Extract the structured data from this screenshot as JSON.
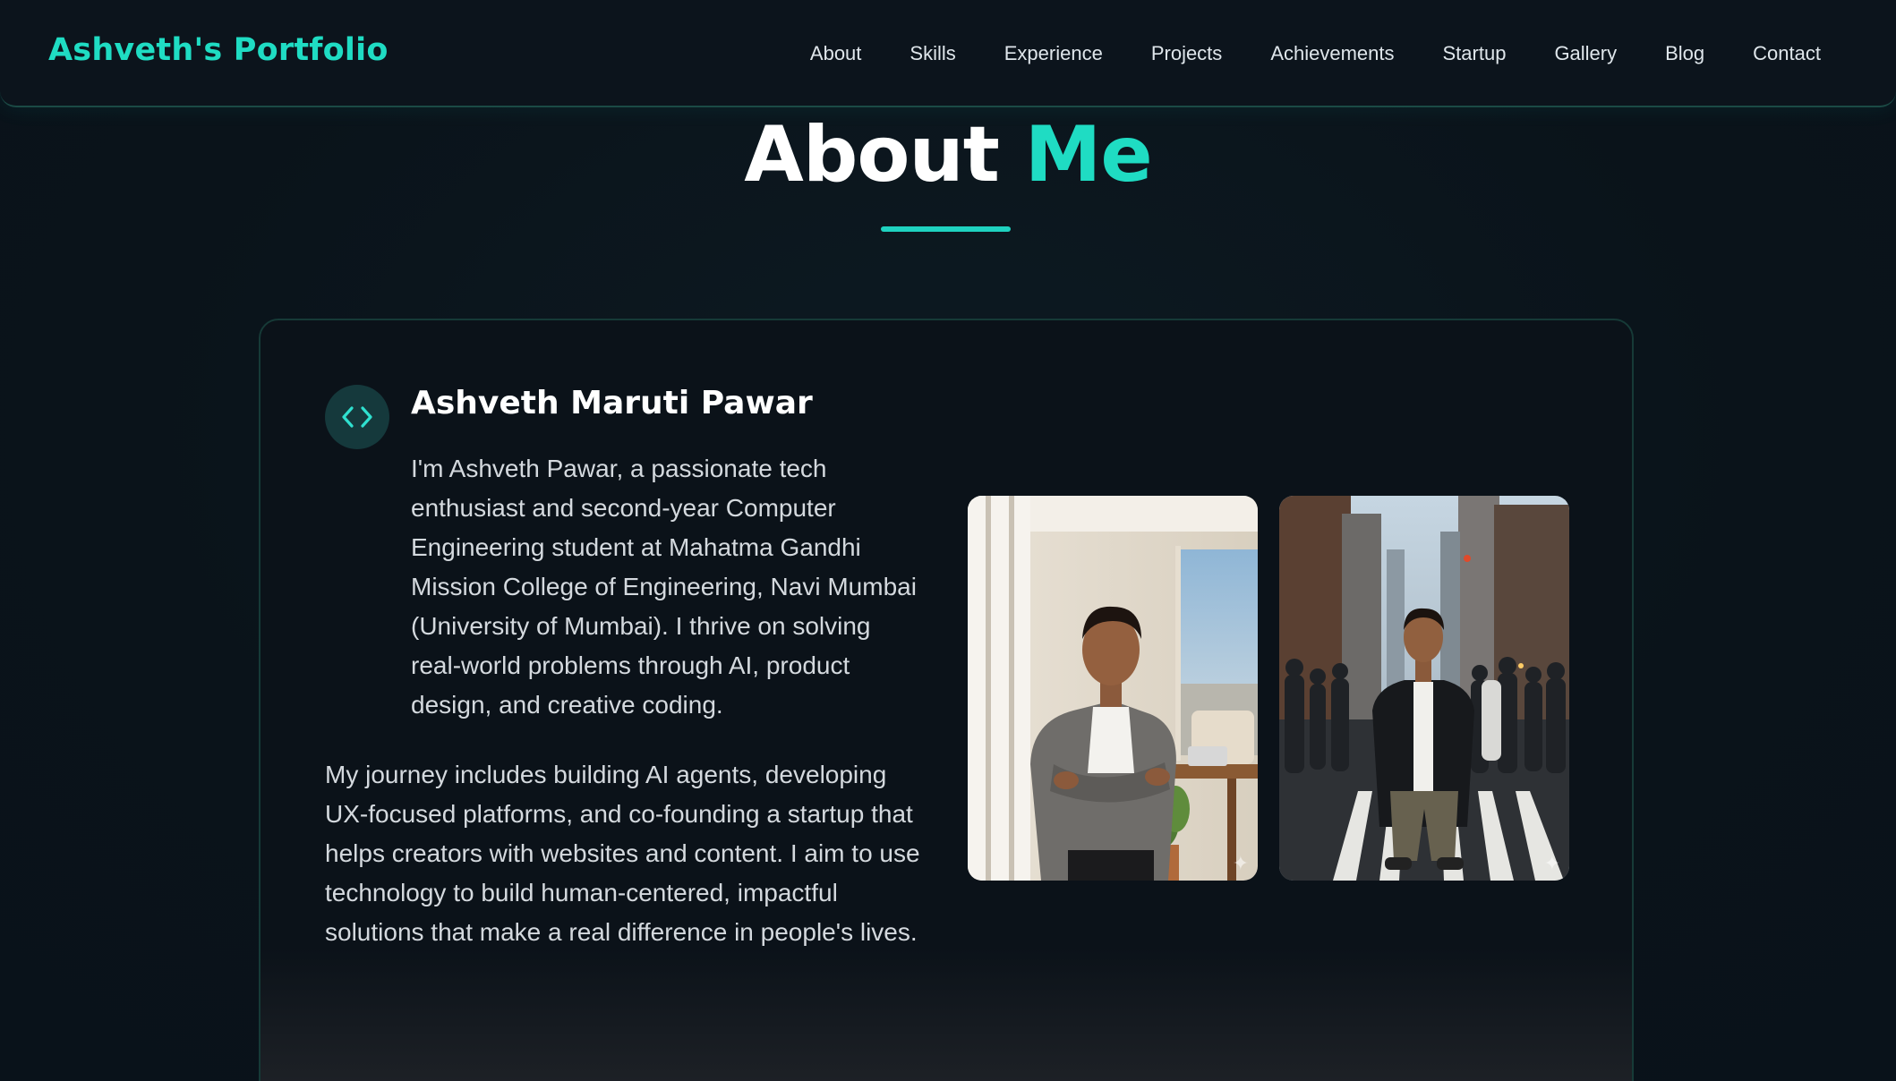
{
  "header": {
    "brand": "Ashveth's Portfolio",
    "nav": [
      "About",
      "Skills",
      "Experience",
      "Projects",
      "Achievements",
      "Startup",
      "Gallery",
      "Blog",
      "Contact"
    ]
  },
  "about": {
    "title_main": "About",
    "title_accent": "Me",
    "badge_icon": "code-icon",
    "name": "Ashveth Maruti Pawar",
    "paragraph_1": "I'm Ashveth Pawar, a passionate tech enthusiast and second-year Computer Engineering student at Mahatma Gandhi Mission College of Engineering, Navi Mumbai (University of Mumbai). I thrive on solving real-world problems through AI, product design, and creative coding.",
    "paragraph_2": "My journey includes building AI agents, developing UX-focused platforms, and co-founding a startup that helps creators with websites and content. I aim to use technology to build human-centered, impactful solutions that make a real difference in people's lives.",
    "photos": [
      "photo-office",
      "photo-street"
    ],
    "sparkle_glyph": "✦"
  },
  "colors": {
    "accent": "#1fdcc3",
    "background": "#0b141c",
    "card_border": "#163a37"
  }
}
